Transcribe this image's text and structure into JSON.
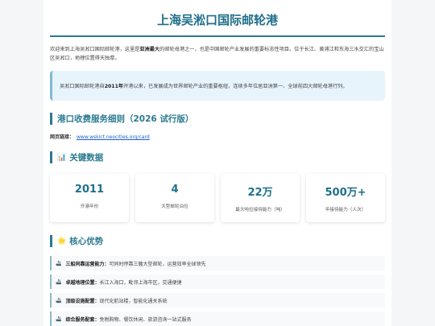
{
  "title": "上海吴淞口国际邮轮港",
  "intro": {
    "p1": "欢迎来到上海吴淞口国际邮轮港，这里是",
    "bold": "亚洲最大",
    "p2": "的邮轮母港之一，也是中国邮轮产业发展的重要标志性项目。位于长江、黄浦江和东海三水交汇的宝山区吴淞口，地理位置得天独厚。"
  },
  "callout": {
    "p1": "吴淞口国际邮轮港自",
    "bold": "2011年",
    "p2": "开港以来，已发展成为世界邮轮产业的重要枢纽，连续多年位居亚洲第一、全球前四大邮轮母港行列。"
  },
  "fee_section": {
    "title": "港口收费服务细则（2026 试行版）",
    "link_label": "网页链接：",
    "link_text": "www.wskict.neocities.org/card"
  },
  "data_section": {
    "icon": "📊",
    "title": "关键数据",
    "stats": [
      {
        "value": "2011",
        "label": "开港年份"
      },
      {
        "value": "4",
        "label": "大型邮轮泊位"
      },
      {
        "value": "22万",
        "label": "最大吨位接待能力（吨）"
      },
      {
        "value": "500万+",
        "label": "年接待能力（人次）"
      }
    ]
  },
  "advantages_section": {
    "icon": "🌟",
    "title": "核心优势",
    "items": [
      {
        "icon": "🚢",
        "title": "三船同靠运营能力：",
        "text": "可同时停靠三艘大型邮轮，运营效率全球领先"
      },
      {
        "icon": "🚢",
        "title": "卓越地理位置：",
        "text": "长江入海口，毗邻上海市区，交通便捷"
      },
      {
        "icon": "🚢",
        "title": "顶级设施配置：",
        "text": "现代化航站楼，智能化通关系统"
      },
      {
        "icon": "🚢",
        "title": "综合服务配套：",
        "text": "免税购物、餐饮休闲、旅游咨询一站式服务"
      }
    ]
  },
  "colors": {
    "accent": "#2b7a90",
    "title": "#1f6f8b",
    "link": "#1a5fd0",
    "callout_bg": "#e8f4fb"
  }
}
